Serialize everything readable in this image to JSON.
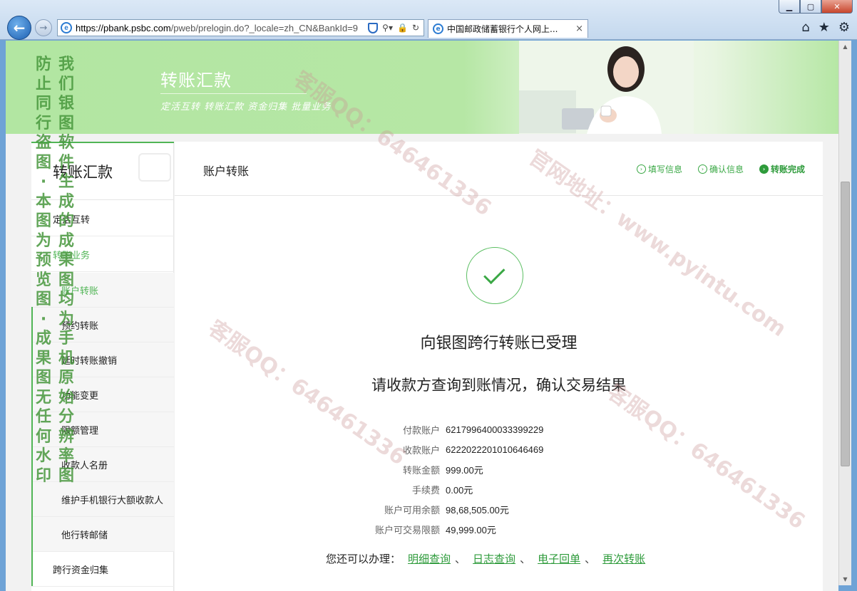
{
  "browser": {
    "window_buttons": {
      "minimize": "▁",
      "maximize": "▢",
      "close": "✕"
    },
    "back_icon": "arrow-left-icon",
    "forward_icon": "arrow-right-icon",
    "url_host": "https://pbank.psbc.com",
    "url_path": "/pweb/prelogin.do?_locale=zh_CN&BankId=9",
    "tab_title": "中国邮政储蓄银行个人网上...",
    "tab_close": "×",
    "tools": [
      "home-icon",
      "star-icon",
      "gear-icon"
    ]
  },
  "banner": {
    "title": "转账汇款",
    "subtitle": "定活互转 转账汇款 资金归集 批量业务"
  },
  "sidebar": {
    "title": "转账汇款",
    "items": [
      {
        "label": "定活互转",
        "kind": "top"
      },
      {
        "label": "转账业务",
        "kind": "group"
      },
      {
        "label": "账户转账",
        "kind": "sub-active"
      },
      {
        "label": "预约转账",
        "kind": "sub"
      },
      {
        "label": "延时转账撤销",
        "kind": "sub"
      },
      {
        "label": "功能变更",
        "kind": "sub"
      },
      {
        "label": "限额管理",
        "kind": "sub"
      },
      {
        "label": "收款人名册",
        "kind": "sub"
      },
      {
        "label": "维护手机银行大额收款人",
        "kind": "sub"
      },
      {
        "label": "他行转邮储",
        "kind": "sub"
      },
      {
        "label": "跨行资金归集",
        "kind": "top"
      }
    ]
  },
  "main": {
    "title": "账户转账",
    "steps": [
      {
        "label": "填写信息",
        "state": "todo"
      },
      {
        "label": "确认信息",
        "state": "todo"
      },
      {
        "label": "转账完成",
        "state": "done"
      }
    ],
    "result_title": "向银图跨行转账已受理",
    "result_subtitle": "请收款方查询到账情况，确认交易结果",
    "details": [
      {
        "label": "付款账户",
        "value": "6217996400033399229"
      },
      {
        "label": "收款账户",
        "value": "6222022201010646469"
      },
      {
        "label": "转账金额",
        "value": "999.00元"
      },
      {
        "label": "手续费",
        "value": "0.00元"
      },
      {
        "label": "账户可用余额",
        "value": "98,68,505.00元"
      },
      {
        "label": "账户可交易限额",
        "value": "49,999.00元"
      }
    ],
    "more_prompt": "您还可以办理：",
    "more_links": [
      "明细查询",
      "日志查询",
      "电子回单",
      "再次转账"
    ],
    "more_sep": "、"
  },
  "watermark": {
    "col1": "防止同行盗图·本图为预览图·成果图无任何水印",
    "col2": "我们银图软件生成的成果图均为手机原始分辨率图",
    "diagonal": [
      "客服QQ：646461336",
      "官网地址：www.pyintu.com"
    ]
  },
  "colors": {
    "accent": "#51b556",
    "banner": "#b6e7a5",
    "link": "#2e9b3b"
  }
}
